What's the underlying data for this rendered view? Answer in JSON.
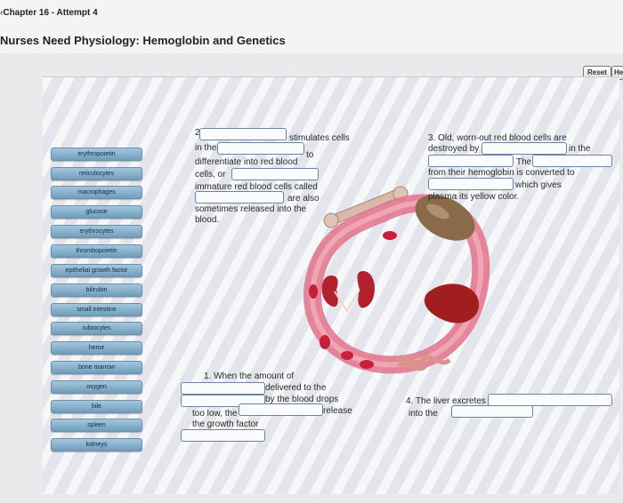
{
  "header": {
    "back_glyph": "‹",
    "chapter": "Chapter 16 - Attempt 4",
    "title": "Nurses Need Physiology: Hemoglobin and Genetics",
    "reset_label": "Reset",
    "help_label": "He"
  },
  "labels": [
    "erythropoietin",
    "reticulocytes",
    "macrophages",
    "glucose",
    "erythrocytes",
    "thrombopoietin",
    "epithelial growth factor",
    "bilirubin",
    "small intestine",
    "rubiocytes",
    "heme",
    "bone marrow",
    "oxygen",
    "bile",
    "spleen",
    "kidneys"
  ],
  "step2": {
    "num": "2",
    "t1": "stimulates cells",
    "t2": "in the",
    "t3": "to",
    "t4": "differentiate into red blood",
    "t5": "cells, or",
    "t6": "immature red blood cells called",
    "t7": "are also",
    "t8": "sometimes released into the",
    "t9": "blood."
  },
  "step3": {
    "t1": "3. Old, worn-out red blood cells are",
    "t2": "destroyed by",
    "t3": "in the",
    "t4": "The",
    "t5": "from their hemoglobin is converted to",
    "t6": "which gives",
    "t7": "plasma its yellow color."
  },
  "step1": {
    "t1": "1. When the amount of",
    "t2": "delivered to the",
    "t3": "by the blood drops",
    "t4": "too low, the",
    "t5": "release",
    "t6": "the growth factor"
  },
  "step4": {
    "t1": "4. The liver excretes",
    "t2": "into the"
  },
  "colors": {
    "tile": "#8bb3d0",
    "vessel": "#e3728a",
    "blood_cell": "#c81e3a",
    "kidney": "#b3202e",
    "liver": "#a11e1e",
    "spleen": "#8a6a48"
  }
}
